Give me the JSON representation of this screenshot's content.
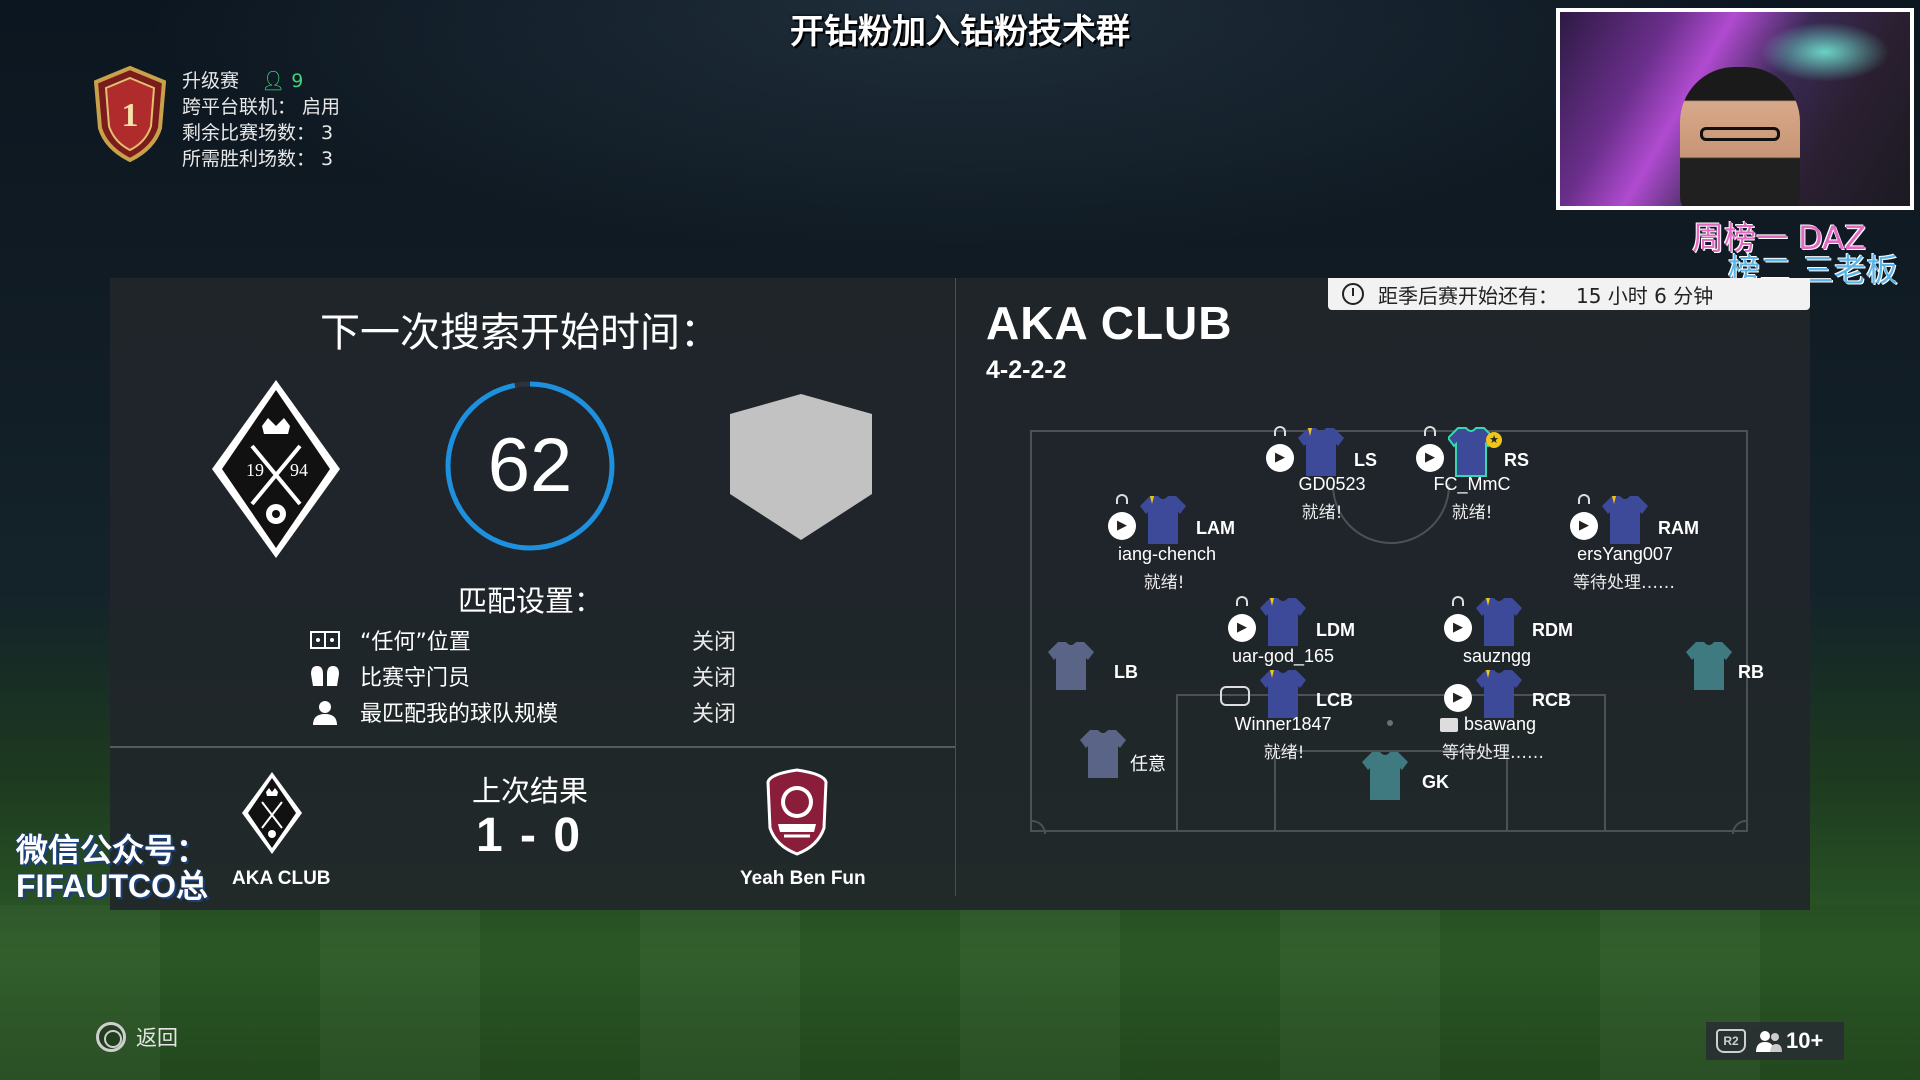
{
  "overlay": {
    "banner": "开钻粉加入钻粉技术群",
    "rank_line1": "周榜一 DAZ",
    "rank_line2": "榜二 三老板",
    "wechat_line1": "微信公众号：",
    "wechat_line2": "FIFAUTCO总"
  },
  "tournament": {
    "badge_number": "1",
    "name": "升级赛",
    "players_online": "9",
    "crossplay": "跨平台联机：  启用",
    "remaining": "剩余比赛场数：  3",
    "wins_needed": "所需胜利场数：  3"
  },
  "search": {
    "title": "下一次搜索开始时间：",
    "countdown": "62",
    "countdown_fraction": 0.97,
    "crest_year_left": "19",
    "crest_year_right": "94"
  },
  "match_settings": {
    "title": "匹配设置：",
    "rows": [
      {
        "icon": "position-icon",
        "label": "“任何”位置",
        "value": "关闭"
      },
      {
        "icon": "gloves-icon",
        "label": "比赛守门员",
        "value": "关闭"
      },
      {
        "icon": "person-icon",
        "label": "最匹配我的球队规模",
        "value": "关闭"
      }
    ]
  },
  "last_result": {
    "title": "上次结果",
    "score": "1 - 0",
    "home_name": "AKA CLUB",
    "away_name": "Yeah Ben Fun"
  },
  "club": {
    "name": "AKA CLUB",
    "formation": "4-2-2-2",
    "countdown_label": "距季后赛开始还有：",
    "countdown_value": "15 小时 6 分钟"
  },
  "lineup": {
    "ls": {
      "pos": "LS",
      "name": "GD0523",
      "status": "就绪!"
    },
    "rs": {
      "pos": "RS",
      "name": "FC_MmC",
      "status": "就绪!"
    },
    "lam": {
      "pos": "LAM",
      "name": "iang-chench",
      "status": "就绪!"
    },
    "ram": {
      "pos": "RAM",
      "name": "ersYang007",
      "status": "等待处理……"
    },
    "ldm": {
      "pos": "LDM",
      "name": "uar-god_165",
      "status": ""
    },
    "rdm": {
      "pos": "RDM",
      "name": "sauzngg",
      "status": ""
    },
    "lb": {
      "pos": "LB"
    },
    "rb": {
      "pos": "RB"
    },
    "any": {
      "pos": "任意"
    },
    "lcb": {
      "pos": "LCB",
      "name": "Winner1847",
      "status": "就绪!"
    },
    "rcb": {
      "pos": "RCB",
      "name": "bsawang",
      "status": "等待处理……"
    },
    "gk": {
      "pos": "GK"
    }
  },
  "controls": {
    "back": "返回",
    "r2": "R2",
    "party_count": "10+"
  },
  "colors": {
    "ring": "#1e90e0",
    "jersey": "#3d4a9a",
    "jersey_empty": "#5a6486",
    "gk_jersey": "#3e7a80",
    "captain": "#f0c419"
  }
}
